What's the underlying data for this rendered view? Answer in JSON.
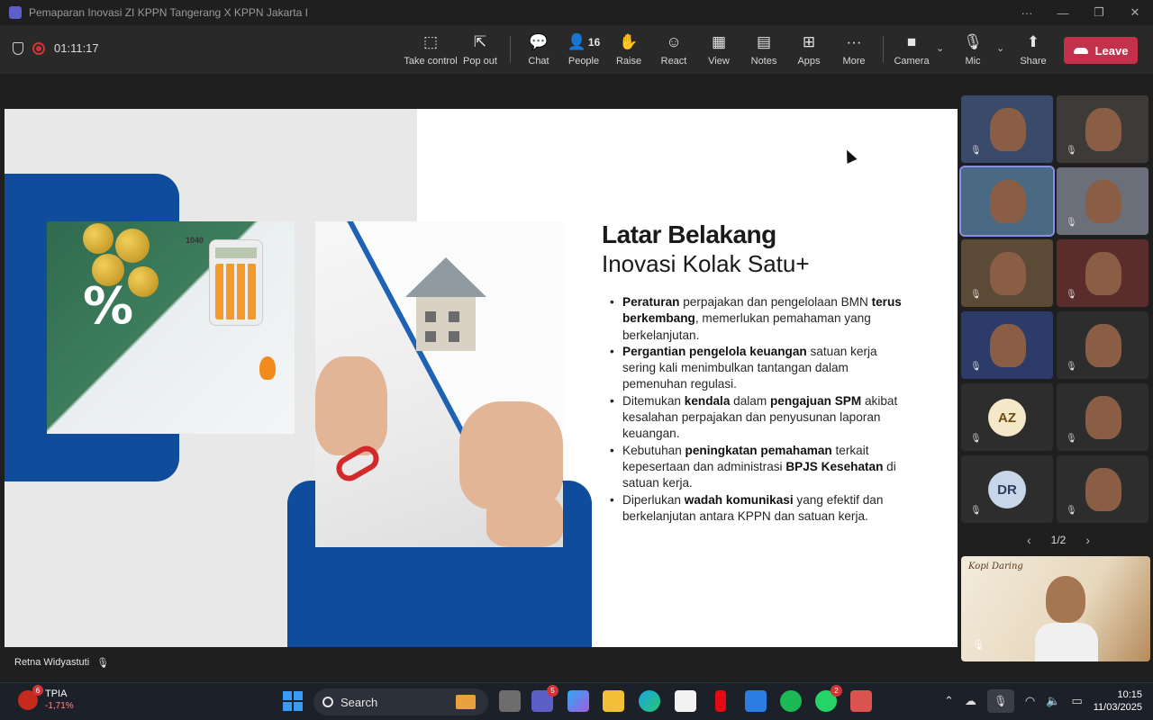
{
  "window": {
    "title": "Pemaparan Inovasi ZI KPPN Tangerang X KPPN Jakarta I",
    "more": "···",
    "minimize": "—",
    "maximize": "❐",
    "close": "✕"
  },
  "meeting": {
    "timer": "01:11:17",
    "toolbar": [
      {
        "label": "Take control",
        "icon": "take-control-icon",
        "glyph": "⬚"
      },
      {
        "label": "Pop out",
        "icon": "pop-out-icon",
        "glyph": "⇱"
      },
      {
        "label": "Chat",
        "icon": "chat-icon",
        "glyph": "💬"
      },
      {
        "label": "People",
        "icon": "people-icon",
        "glyph": "👤",
        "count": "16"
      },
      {
        "label": "Raise",
        "icon": "raise-hand-icon",
        "glyph": "✋"
      },
      {
        "label": "React",
        "icon": "react-icon",
        "glyph": "☺"
      },
      {
        "label": "View",
        "icon": "view-icon",
        "glyph": "▦"
      },
      {
        "label": "Notes",
        "icon": "notes-icon",
        "glyph": "▤"
      },
      {
        "label": "Apps",
        "icon": "apps-icon",
        "glyph": "⊞"
      },
      {
        "label": "More",
        "icon": "more-icon",
        "glyph": "···"
      },
      {
        "label": "Camera",
        "icon": "camera-icon",
        "glyph": "■"
      },
      {
        "label": "Mic",
        "icon": "mic-off-icon",
        "glyph": "🎙"
      },
      {
        "label": "Share",
        "icon": "share-icon",
        "glyph": "⬆"
      }
    ],
    "leave_label": "Leave",
    "presenter": "Retna Widyastuti",
    "pager": "1/2",
    "participants": [
      {
        "initials": "",
        "muted": true
      },
      {
        "initials": "",
        "muted": true
      },
      {
        "initials": "",
        "muted": false,
        "active": true
      },
      {
        "initials": "",
        "muted": true
      },
      {
        "initials": "",
        "muted": true
      },
      {
        "initials": "",
        "muted": true
      },
      {
        "initials": "",
        "muted": true
      },
      {
        "initials": "",
        "muted": true
      },
      {
        "initials": "AZ",
        "muted": true,
        "bg": "#f5e8c8",
        "fg": "#6b4b14"
      },
      {
        "initials": "",
        "muted": true
      },
      {
        "initials": "DR",
        "muted": true,
        "bg": "#c9d6ea",
        "fg": "#2c3e5c"
      },
      {
        "initials": "",
        "muted": true
      }
    ]
  },
  "slide": {
    "title": "Latar Belakang",
    "subtitle": "Inovasi Kolak Satu+",
    "bullets": [
      [
        {
          "b": "Peraturan"
        },
        {
          "t": " perpajakan dan pengelolaan BMN "
        },
        {
          "b": "terus berkembang"
        },
        {
          "t": ", memerlukan pemahaman yang berkelanjutan."
        }
      ],
      [
        {
          "b": "Pergantian pengelola keuangan"
        },
        {
          "t": " satuan kerja sering kali menimbulkan tantangan dalam pemenuhan regulasi."
        }
      ],
      [
        {
          "t": "Ditemukan "
        },
        {
          "b": "kendala"
        },
        {
          "t": " dalam "
        },
        {
          "b": "pengajuan SPM"
        },
        {
          "t": " akibat kesalahan perpajakan dan penyusunan laporan keuangan."
        }
      ],
      [
        {
          "t": "Kebutuhan "
        },
        {
          "b": "peningkatan pemahaman"
        },
        {
          "t": " terkait kepesertaan dan administrasi "
        },
        {
          "b": "BPJS Kesehatan"
        },
        {
          "t": " di satuan kerja."
        }
      ],
      [
        {
          "t": "Diperlukan "
        },
        {
          "b": "wadah komunikasi"
        },
        {
          "t": " yang efektif dan berkelanjutan antara KPPN dan satuan kerja."
        }
      ]
    ],
    "photo1_labels": {
      "form": "1040",
      "pct": "%"
    }
  },
  "self_view": {
    "overlay_text": "Kopi Daring"
  },
  "taskbar": {
    "widget_badge": "6",
    "stock_name": "TPIA",
    "stock_change": "-1,71%",
    "search_placeholder": "Search",
    "teams_badge": "5",
    "whatsapp_badge": "2",
    "time": "10:15",
    "date": "11/03/2025"
  },
  "colors": {
    "brand_blue": "#0f4c9c",
    "leave_red": "#c4314b",
    "teams_purple": "#5b5fc7"
  }
}
